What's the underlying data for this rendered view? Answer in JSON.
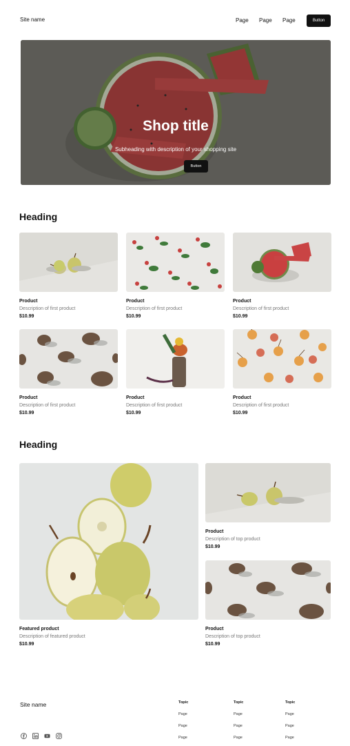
{
  "header": {
    "site_name": "Site name",
    "nav": [
      "Page",
      "Page",
      "Page"
    ],
    "button": "Button"
  },
  "hero": {
    "title": "Shop title",
    "subheading": "Subheading with description of your shopping site",
    "button": "Button"
  },
  "section1": {
    "heading": "Heading",
    "products": [
      {
        "name": "Product",
        "description": "Description of first product",
        "price": "$10.99"
      },
      {
        "name": "Product",
        "description": "Description of first product",
        "price": "$10.99"
      },
      {
        "name": "Product",
        "description": "Description of first product",
        "price": "$10.99"
      },
      {
        "name": "Product",
        "description": "Description of first product",
        "price": "$10.99"
      },
      {
        "name": "Product",
        "description": "Description of first product",
        "price": "$10.99"
      },
      {
        "name": "Product",
        "description": "Description of first product",
        "price": "$10.99"
      }
    ]
  },
  "section2": {
    "heading": "Heading",
    "featured": {
      "name": "Featured product",
      "description": "Description of featured product",
      "price": "$10.99"
    },
    "top": [
      {
        "name": "Product",
        "description": "Description of top product",
        "price": "$10.99"
      },
      {
        "name": "Product",
        "description": "Description of top product",
        "price": "$10.99"
      }
    ]
  },
  "footer": {
    "site_name": "Site name",
    "columns": [
      {
        "topic": "Topic",
        "links": [
          "Page",
          "Page",
          "Page"
        ]
      },
      {
        "topic": "Topic",
        "links": [
          "Page",
          "Page",
          "Page"
        ]
      },
      {
        "topic": "Topic",
        "links": [
          "Page",
          "Page",
          "Page"
        ]
      }
    ],
    "social_icons": [
      "facebook-icon",
      "linkedin-icon",
      "youtube-icon",
      "instagram-icon"
    ]
  },
  "colors": {
    "button_bg": "#111111",
    "price_text": "#111111",
    "description_text": "#777777"
  }
}
